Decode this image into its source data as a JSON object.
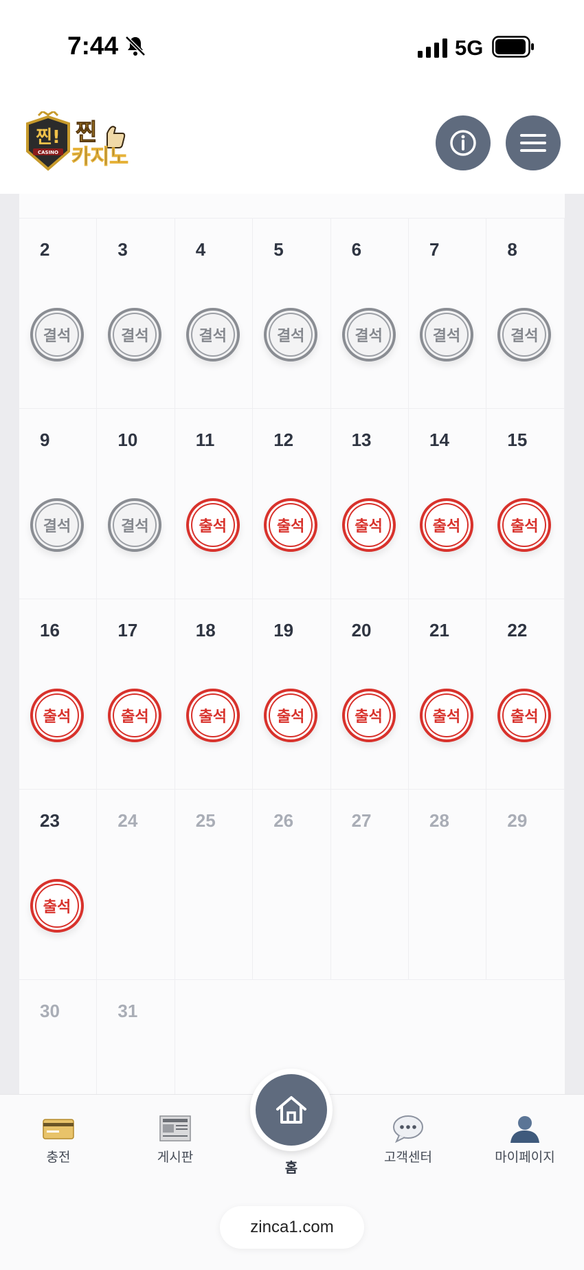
{
  "status_bar": {
    "time": "7:44",
    "network": "5G",
    "icons": [
      "bell-off-icon",
      "signal-icon",
      "battery-icon"
    ]
  },
  "header": {
    "logo_text_top": "찐!",
    "logo_text_badge": "CASINO",
    "logo_text_main_1": "찐",
    "logo_text_main_2": "카지노",
    "buttons": [
      "info-icon",
      "menu-icon"
    ]
  },
  "calendar": {
    "stamp_absent_label": "결석",
    "stamp_present_label": "출석",
    "colors": {
      "absent": "#8a8d93",
      "present": "#d8322c"
    },
    "weeks": [
      [
        {
          "day": "2",
          "status": "absent"
        },
        {
          "day": "3",
          "status": "absent"
        },
        {
          "day": "4",
          "status": "absent"
        },
        {
          "day": "5",
          "status": "absent"
        },
        {
          "day": "6",
          "status": "absent"
        },
        {
          "day": "7",
          "status": "absent"
        },
        {
          "day": "8",
          "status": "absent"
        }
      ],
      [
        {
          "day": "9",
          "status": "absent"
        },
        {
          "day": "10",
          "status": "absent"
        },
        {
          "day": "11",
          "status": "present"
        },
        {
          "day": "12",
          "status": "present"
        },
        {
          "day": "13",
          "status": "present"
        },
        {
          "day": "14",
          "status": "present"
        },
        {
          "day": "15",
          "status": "present"
        }
      ],
      [
        {
          "day": "16",
          "status": "present"
        },
        {
          "day": "17",
          "status": "present"
        },
        {
          "day": "18",
          "status": "present"
        },
        {
          "day": "19",
          "status": "present"
        },
        {
          "day": "20",
          "status": "present"
        },
        {
          "day": "21",
          "status": "present"
        },
        {
          "day": "22",
          "status": "present"
        }
      ],
      [
        {
          "day": "23",
          "status": "present"
        },
        {
          "day": "24",
          "status": "future"
        },
        {
          "day": "25",
          "status": "future"
        },
        {
          "day": "26",
          "status": "future"
        },
        {
          "day": "27",
          "status": "future"
        },
        {
          "day": "28",
          "status": "future"
        },
        {
          "day": "29",
          "status": "future"
        }
      ],
      [
        {
          "day": "30",
          "status": "future"
        },
        {
          "day": "31",
          "status": "future"
        }
      ]
    ]
  },
  "bottom_nav": {
    "items": [
      {
        "label": "충전",
        "icon": "credit-card-icon"
      },
      {
        "label": "게시판",
        "icon": "newspaper-icon"
      },
      {
        "label": "홈",
        "icon": "home-icon"
      },
      {
        "label": "고객센터",
        "icon": "chat-bubble-icon"
      },
      {
        "label": "마이페이지",
        "icon": "user-icon"
      }
    ]
  },
  "browser": {
    "url": "zinca1.com"
  }
}
